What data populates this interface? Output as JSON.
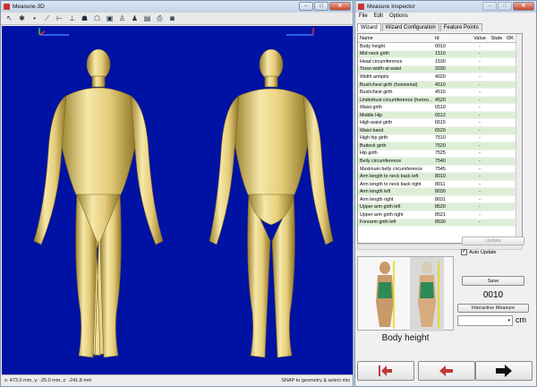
{
  "left_window": {
    "title": "Measure-3D",
    "status_coords": "x: 473.0 mm, y: -25.0 mm, z: -241.8 mm",
    "status_mode": "SNAP to geometry & select mix"
  },
  "right_window": {
    "title": "Measure Inspector",
    "menu": [
      "File",
      "Edit",
      "Options"
    ],
    "tabs": [
      "Wizard",
      "Wizard Configuration",
      "Feature Points"
    ],
    "columns": [
      "Name",
      "Id",
      "Value",
      "State",
      "OK"
    ],
    "rows": [
      {
        "name": "Body height",
        "id": "0010",
        "value": "-",
        "mark": ""
      },
      {
        "name": "Mid neck girth",
        "id": "1510",
        "value": "-",
        "mark": "#3b7fd0"
      },
      {
        "name": "Head circumference",
        "id": "1530",
        "value": "-",
        "mark": "#3b7fd0"
      },
      {
        "name": "Torso width at waist",
        "id": "2030",
        "value": "-",
        "mark": "#9a6ad0"
      },
      {
        "name": "Width armpits",
        "id": "4020",
        "value": "-",
        "mark": "#d0407a"
      },
      {
        "name": "Bust/chest girth (horizontal)",
        "id": "4510",
        "value": "-",
        "mark": "#d0407a"
      },
      {
        "name": "Bust/chest girth",
        "id": "4515",
        "value": "-",
        "mark": "#d0407a"
      },
      {
        "name": "Underbust circumference (horizo...",
        "id": "4520",
        "value": "-",
        "mark": "#d0407a"
      },
      {
        "name": "Waist girth",
        "id": "6510",
        "value": "-",
        "mark": "#7a8a55"
      },
      {
        "name": "Middle Hip",
        "id": "6512",
        "value": "-",
        "mark": "#7a8a55"
      },
      {
        "name": "High waist girth",
        "id": "6515",
        "value": "-",
        "mark": "#7a8a55"
      },
      {
        "name": "Waist band",
        "id": "6520",
        "value": "-",
        "mark": "#7a8a55"
      },
      {
        "name": "High hip girth",
        "id": "7510",
        "value": "-",
        "mark": "#7a8a55"
      },
      {
        "name": "Buttock girth",
        "id": "7520",
        "value": "-",
        "mark": "#7a8a55"
      },
      {
        "name": "Hip girth",
        "id": "7525",
        "value": "-",
        "mark": "#4fd04f"
      },
      {
        "name": "Belly circumference",
        "id": "7540",
        "value": "-",
        "mark": "#4fd04f"
      },
      {
        "name": "Maximum belly circumference",
        "id": "7545",
        "value": "-",
        "mark": ""
      },
      {
        "name": "Arm length to neck back left",
        "id": "8010",
        "value": "-",
        "mark": ""
      },
      {
        "name": "Arm length to neck back right",
        "id": "8011",
        "value": "-",
        "mark": ""
      },
      {
        "name": "Arm length left",
        "id": "8030",
        "value": "-",
        "mark": ""
      },
      {
        "name": "Arm length right",
        "id": "8031",
        "value": "-",
        "mark": ""
      },
      {
        "name": "Upper arm girth left",
        "id": "8520",
        "value": "-",
        "mark": ""
      },
      {
        "name": "Upper arm girth right",
        "id": "8521",
        "value": "-",
        "mark": ""
      },
      {
        "name": "Forearm girth left",
        "id": "8530",
        "value": "-",
        "mark": ""
      }
    ],
    "update_label": "Update",
    "auto_update_label": "Auto Update",
    "save_label": "Save",
    "measure_id": "0010",
    "interactive_label": "Interactive Measure",
    "unit": "cm",
    "measure_name": "Body height",
    "nav": [
      "first-icon",
      "back-icon",
      "next-icon"
    ]
  }
}
